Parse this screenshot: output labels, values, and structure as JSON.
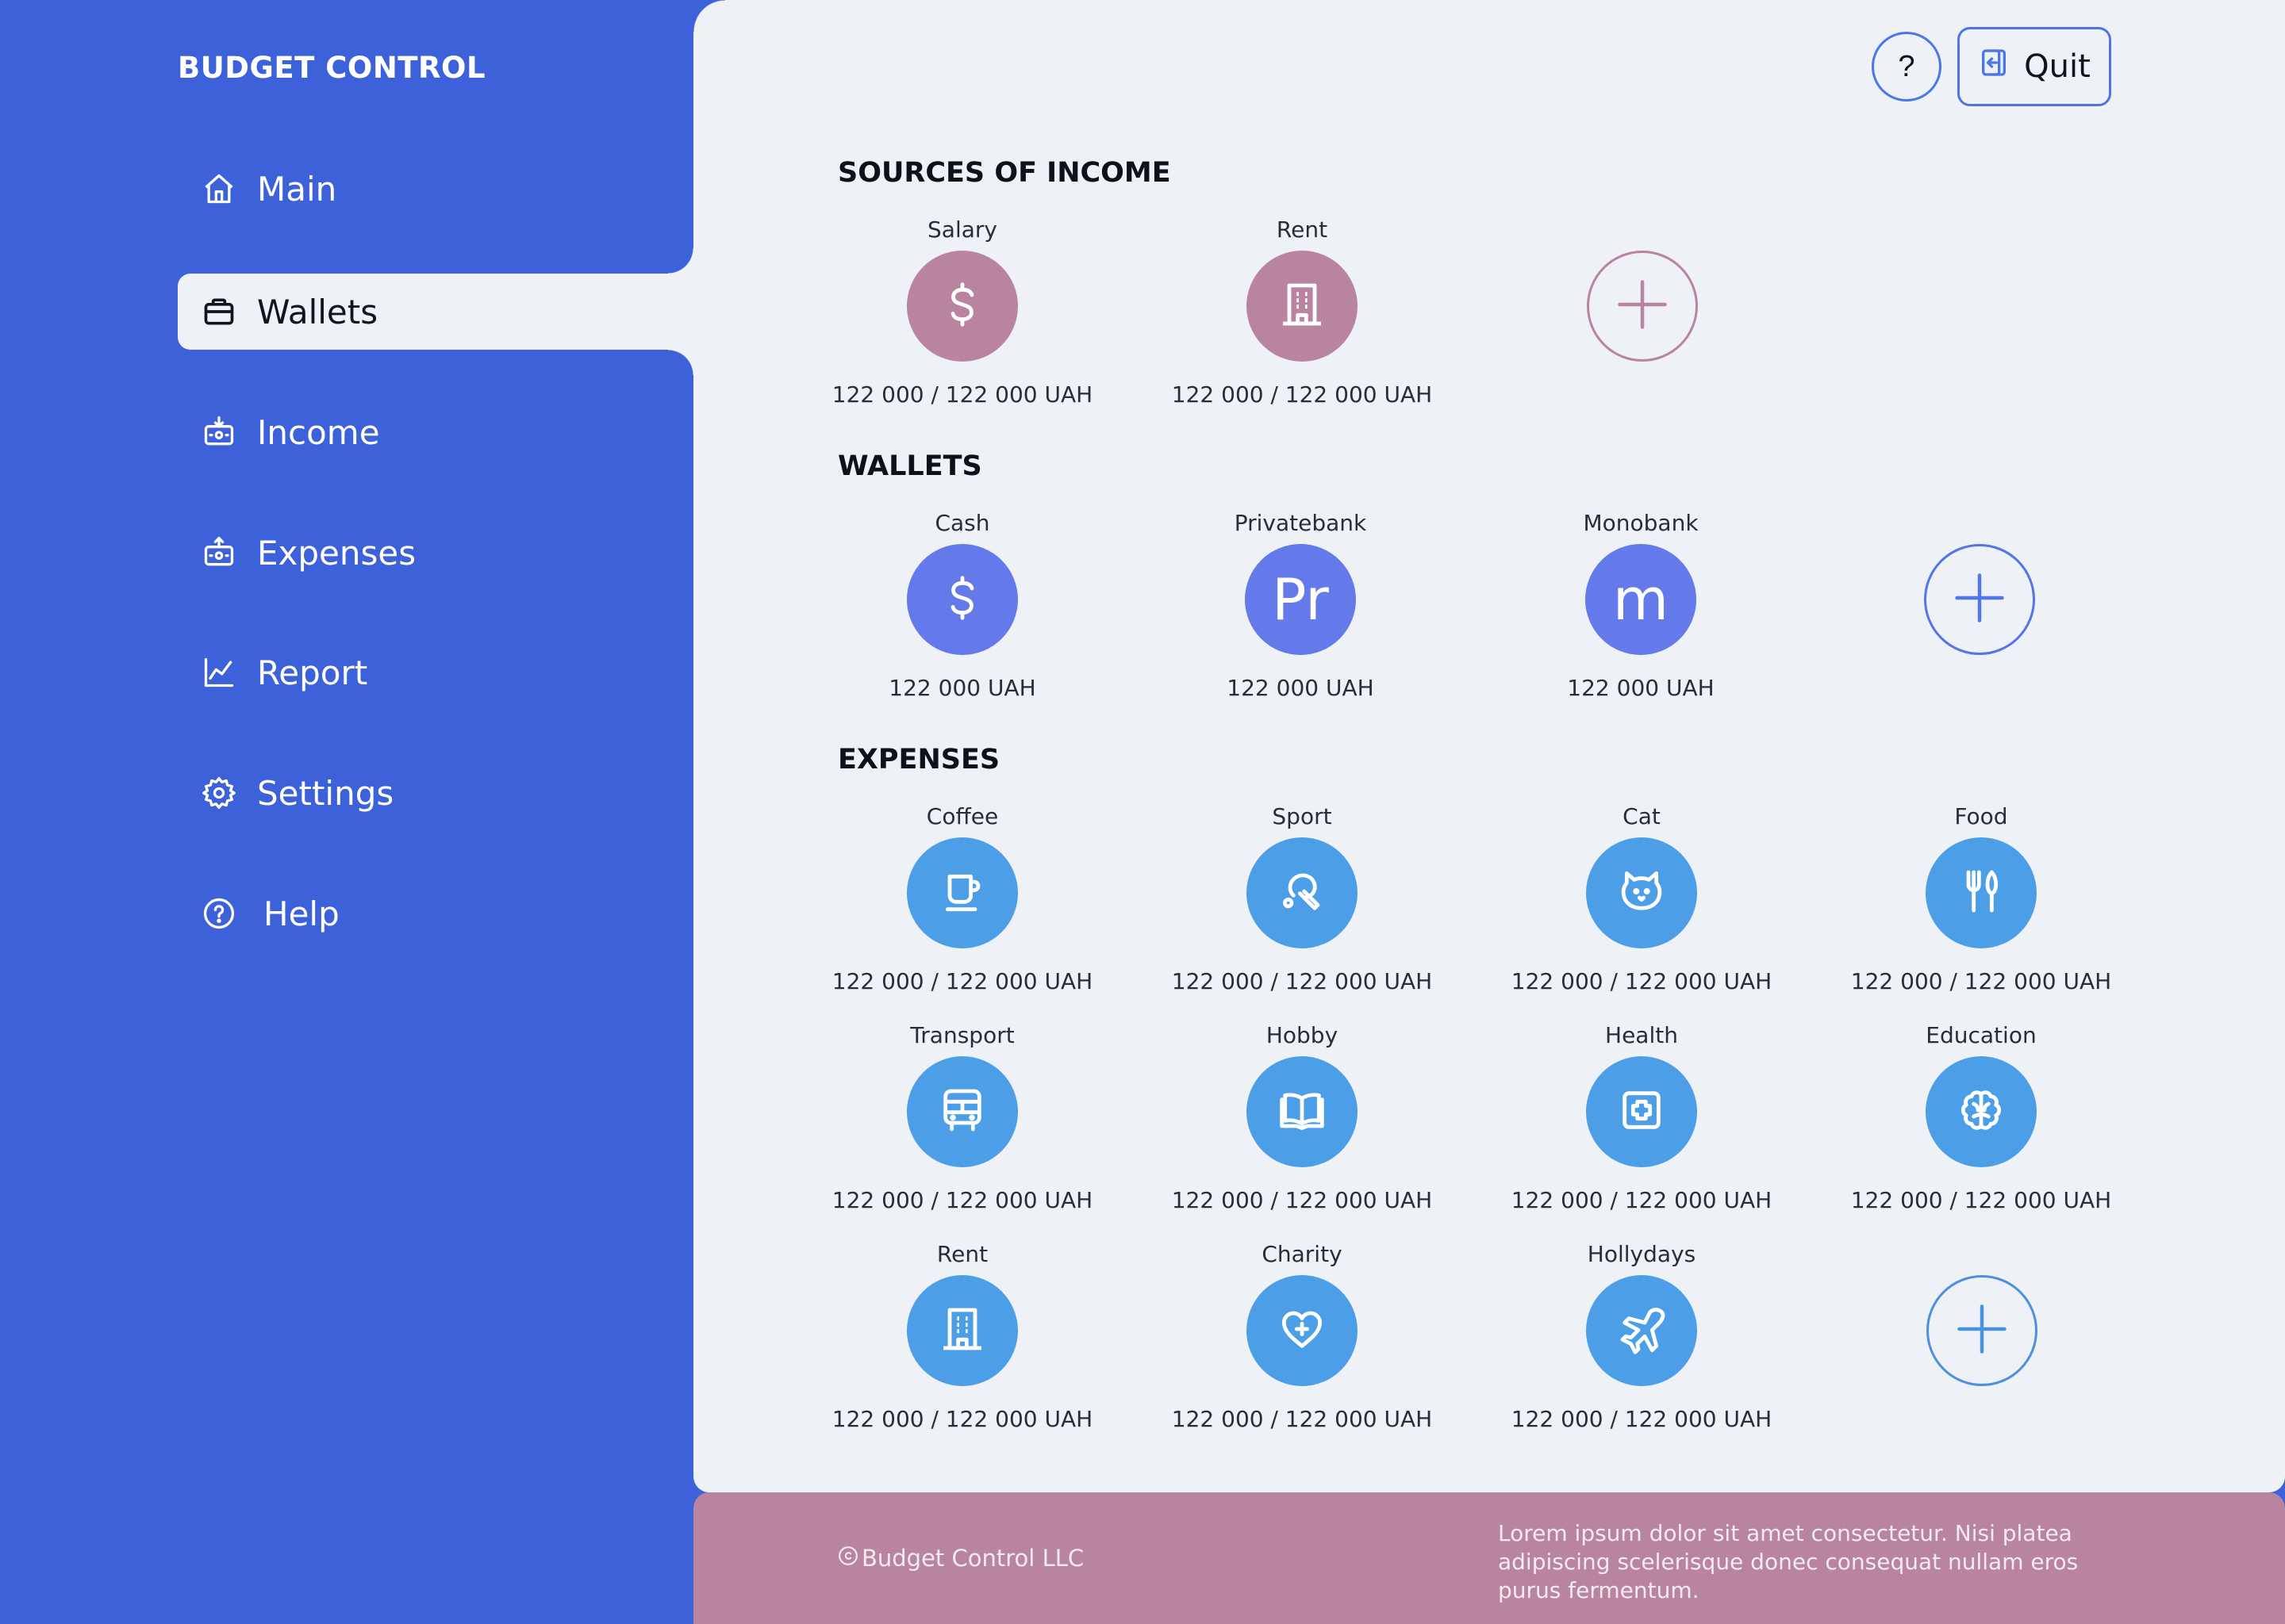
{
  "app": {
    "title": "BUDGET CONTROL"
  },
  "sidebar": {
    "items": [
      {
        "label": "Main",
        "icon": "home-icon"
      },
      {
        "label": "Wallets",
        "icon": "wallet-icon",
        "active": true
      },
      {
        "label": "Income",
        "icon": "income-icon"
      },
      {
        "label": "Expenses",
        "icon": "expenses-icon"
      },
      {
        "label": "Report",
        "icon": "chart-icon"
      },
      {
        "label": "Settings",
        "icon": "gear-icon"
      },
      {
        "label": "Help",
        "icon": "help-circle-icon"
      }
    ]
  },
  "header": {
    "help_label": "?",
    "quit_label": "Quit"
  },
  "sources": {
    "title": "SOURCES OF INCOME",
    "items": [
      {
        "name": "Salary",
        "amount": "122 000 / 122 000 UAH",
        "icon": "dollar-icon"
      },
      {
        "name": "Rent",
        "amount": "122 000 / 122 000 UAH",
        "icon": "building-icon"
      }
    ]
  },
  "wallets": {
    "title": "WALLETS",
    "items": [
      {
        "name": "Cash",
        "amount": "122 000 UAH",
        "icon": "dollar-icon"
      },
      {
        "name": "Privatebank",
        "amount": "122 000 UAH",
        "glyph": "Pr"
      },
      {
        "name": "Monobank",
        "amount": "122 000 UAH",
        "glyph": "m"
      }
    ]
  },
  "expenses": {
    "title": "EXPENSES",
    "items": [
      {
        "name": "Coffee",
        "amount": "122 000 / 122 000 UAH",
        "icon": "coffee-icon"
      },
      {
        "name": "Sport",
        "amount": "122 000 / 122 000 UAH",
        "icon": "ping-pong-icon"
      },
      {
        "name": "Cat",
        "amount": "122 000 / 122 000 UAH",
        "icon": "cat-icon"
      },
      {
        "name": "Food",
        "amount": "122 000 / 122 000 UAH",
        "icon": "cutlery-icon"
      },
      {
        "name": "Transport",
        "amount": "122 000 / 122 000 UAH",
        "icon": "bus-icon"
      },
      {
        "name": "Hobby",
        "amount": "122 000 / 122 000 UAH",
        "icon": "book-icon"
      },
      {
        "name": "Health",
        "amount": "122 000 / 122 000 UAH",
        "icon": "medical-cross-icon"
      },
      {
        "name": "Education",
        "amount": "122 000 / 122 000 UAH",
        "icon": "brain-icon"
      },
      {
        "name": "Rent",
        "amount": "122 000 / 122 000 UAH",
        "icon": "building-icon"
      },
      {
        "name": "Charity",
        "amount": "122 000 / 122 000 UAH",
        "icon": "heart-plus-icon"
      },
      {
        "name": "Hollydays",
        "amount": "122 000 / 122 000 UAH",
        "icon": "plane-icon"
      }
    ]
  },
  "footer": {
    "copyright": "Budget Control LLC",
    "text": "Lorem ipsum dolor sit amet consectetur. Nisi platea adipiscing scelerisque donec consequat nullam eros purus fermentum."
  },
  "colors": {
    "sidebar_bg": "#3d61d9",
    "main_bg": "#eef1f6",
    "income_accent": "#b9849f",
    "wallet_accent": "#6479ea",
    "expense_accent": "#4c9ee6",
    "footer_bg": "#b9849f"
  }
}
